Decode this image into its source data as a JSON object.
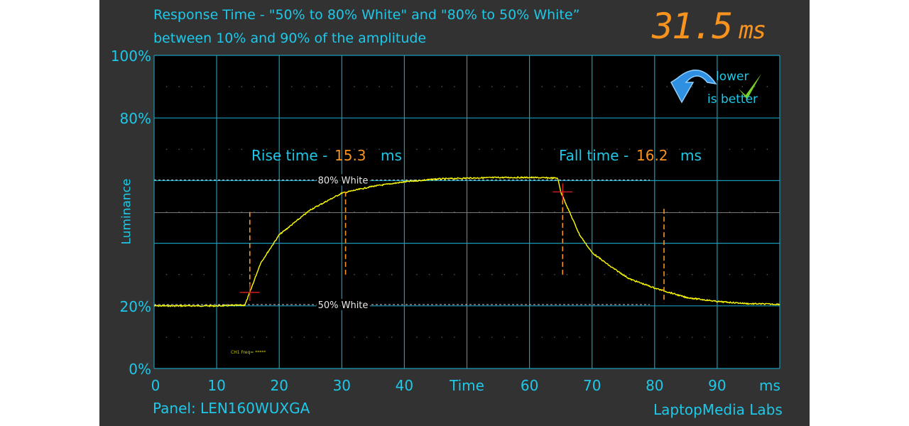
{
  "chart_data": {
    "type": "line",
    "title": "Response Time - \"50% to 80% White\" and \"80% to 50% White”",
    "subtitle": "between 10% and 90% of the amplitude",
    "xlabel": "Time",
    "x_unit": "ms",
    "ylabel": "Luminance",
    "xlim": [
      0,
      100
    ],
    "ylim": [
      0,
      100
    ],
    "x_ticks": [
      "0",
      "10",
      "20",
      "30",
      "40",
      "Time",
      "60",
      "70",
      "80",
      "90",
      "ms"
    ],
    "y_ticks": [
      {
        "value": 100,
        "label": "100%"
      },
      {
        "value": 80,
        "label": "80%"
      },
      {
        "value": 20,
        "label": "20%"
      },
      {
        "value": 0,
        "label": "0%"
      }
    ],
    "grid": true,
    "series": [
      {
        "color": "#ffff00",
        "x": [
          0,
          5,
          10,
          14.5,
          15.3,
          17,
          20,
          25,
          30,
          35,
          40,
          45,
          50,
          55,
          60,
          64.5,
          65,
          66.5,
          68,
          70,
          73,
          76,
          80,
          82,
          85,
          90,
          95,
          100
        ],
        "y": [
          20,
          20,
          20,
          20.2,
          24.3,
          33.6,
          42.7,
          50.7,
          56,
          58.2,
          59.6,
          60.5,
          60.8,
          61,
          61,
          60.8,
          56.4,
          49.5,
          42.7,
          37,
          32.5,
          28.6,
          25.7,
          24.5,
          22.7,
          21.4,
          20.7,
          20.5
        ]
      }
    ],
    "reference_lines": [
      {
        "label": "80% White",
        "y": 60.2
      },
      {
        "label": "50% White",
        "y": 20.4
      }
    ],
    "markers": [
      {
        "type": "cross",
        "x": 15.3,
        "y": 24.3
      },
      {
        "type": "cross",
        "x": 65.3,
        "y": 56.4
      }
    ],
    "interval_lines": [
      {
        "x": 15.3,
        "y": [
          25,
          50
        ]
      },
      {
        "x": 30.6,
        "y": [
          29.5,
          56.5
        ]
      },
      {
        "x": 65.3,
        "y": [
          29.5,
          56.5
        ]
      },
      {
        "x": 81.5,
        "y": [
          21,
          51
        ]
      }
    ],
    "annotations": {
      "rise_label": "Rise time -",
      "rise_value": "15.3",
      "rise_unit": "ms",
      "fall_label": "Fall time -",
      "fall_value": "16.2",
      "fall_unit": "ms",
      "legend_small": "CH1 Freq= *****"
    }
  },
  "total": {
    "value": "31.5",
    "unit": "ms"
  },
  "badge": {
    "line1": "lower",
    "line2": "is better"
  },
  "footer": {
    "panel": "Panel: LEN160WUXGA",
    "brand": "LaptopMedia Labs"
  },
  "colors": {
    "accent": "#1ec8e8",
    "orange": "#f7931e",
    "curve": "#ffff00",
    "grid": "#1b9ab8"
  }
}
